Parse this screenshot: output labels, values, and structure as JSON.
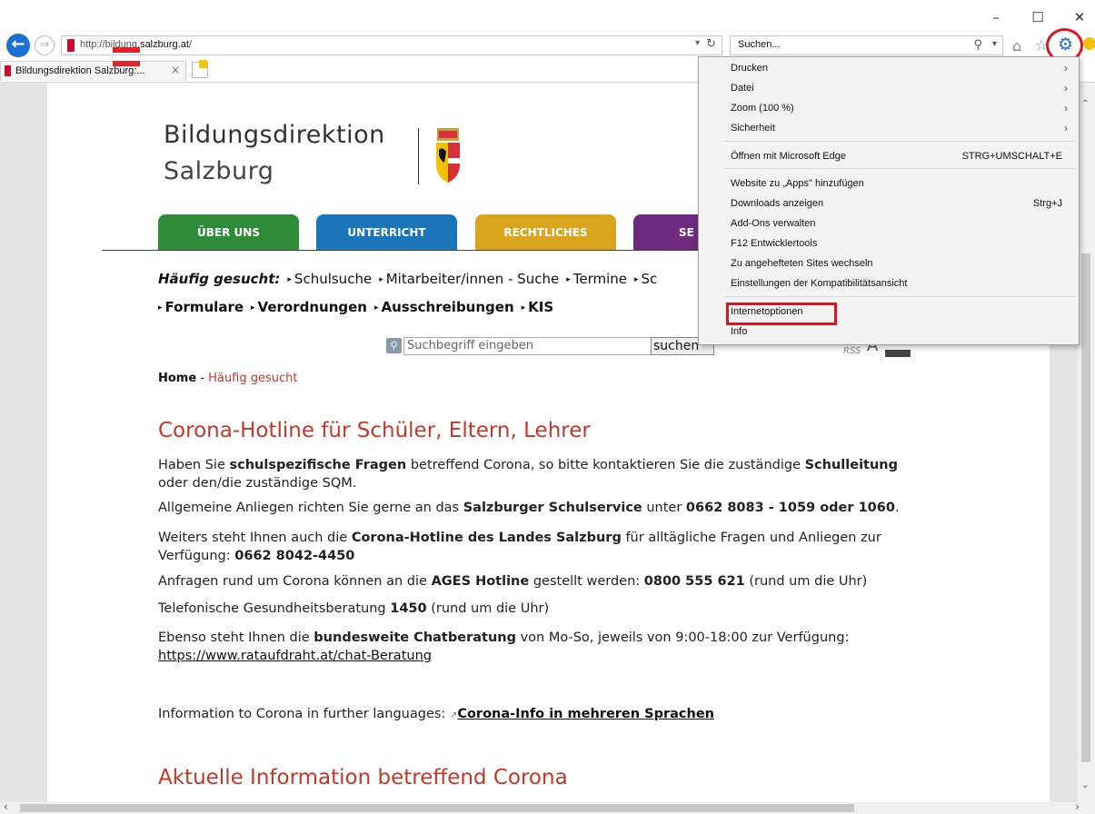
{
  "browser": {
    "window_controls": [
      "–",
      "☐",
      "✕"
    ],
    "address_url_prefix": "http://bildung.",
    "address_url_domain": "salzburg.at",
    "address_url_suffix": "/",
    "search_placeholder": "Suchen...",
    "tab_title": "Bildungsdirektion Salzburg:...",
    "icons": [
      "back-icon",
      "forward-icon",
      "refresh-icon",
      "search-icon",
      "home-icon",
      "star-icon",
      "gear-icon",
      "smiley-icon"
    ]
  },
  "menu": {
    "items": [
      {
        "label": "Drucken",
        "submenu": true
      },
      {
        "label": "Datei",
        "submenu": true
      },
      {
        "label": "Zoom (100 %)",
        "submenu": true
      },
      {
        "label": "Sicherheit",
        "submenu": true
      },
      {
        "label": "Öffnen mit Microsoft Edge",
        "shortcut": "STRG+UMSCHALT+E"
      },
      {
        "label": "Website zu „Apps\" hinzufügen"
      },
      {
        "label": "Downloads anzeigen",
        "shortcut": "Strg+J"
      },
      {
        "label": "Add-Ons verwalten"
      },
      {
        "label": "F12 Entwicklertools"
      },
      {
        "label": "Zu angehefteten Sites wechseln"
      },
      {
        "label": "Einstellungen der Kompatibilitätsansicht"
      },
      {
        "label": "Internetoptionen",
        "highlighted": true
      },
      {
        "label": "Info"
      }
    ]
  },
  "page": {
    "logo_title": "Bildungsdirektion",
    "logo_subtitle": "Salzburg",
    "nav": [
      {
        "label": "ÜBER UNS",
        "color": "#2e8b3a"
      },
      {
        "label": "UNTERRICHT",
        "color": "#1a76b8"
      },
      {
        "label": "RECHTLICHES",
        "color": "#d9a51c"
      },
      {
        "label": "SE",
        "color": "#6e2a7e"
      }
    ],
    "frequent_label": "Häufig gesucht:",
    "frequent_row1": [
      "Schulsuche",
      "Mitarbeiter/innen - Suche",
      "Termine",
      "Sc"
    ],
    "frequent_row2": [
      "Formulare",
      "Verordnungen",
      "Ausschreibungen",
      "KIS"
    ],
    "search_placeholder": "Suchbegriff eingeben",
    "search_button": "suchen",
    "rss": "RSS",
    "font_a": "A",
    "breadcrumb_home": "Home",
    "breadcrumb_sep": " - ",
    "breadcrumb_current": "Häufig gesucht",
    "heading1": "Corona-Hotline für Schüler, Eltern, Lehrer",
    "p1": {
      "a": "Haben Sie ",
      "b": "schulspezifische Fragen",
      "c": " betreffend Corona, so bitte kontaktieren Sie die zuständige ",
      "d": "Schulleitung",
      "e": " oder den/die zuständige SQM."
    },
    "p2": {
      "a": "Allgemeine Anliegen richten Sie gerne an das ",
      "b": "Salzburger Schulservice",
      "c": " unter ",
      "d": "0662 8083 - 1059 oder 1060",
      "e": "."
    },
    "p3": {
      "a": "Weiters steht Ihnen auch die ",
      "b": "Corona-Hotline des Landes Salzburg",
      "c": " für alltägliche Fragen und Anliegen zur Verfügung: ",
      "d": "0662 8042-4450"
    },
    "p4": {
      "a": "Anfragen rund um Corona können an die ",
      "b": "AGES Hotline",
      "c": " gestellt werden: ",
      "d": "0800 555 621",
      "e": " (rund um die Uhr)"
    },
    "p5": {
      "a": "Telefonische Gesundheitsberatung ",
      "b": "1450",
      "c": " (rund um die Uhr)"
    },
    "p6": {
      "a": "Ebenso steht Ihnen die ",
      "b": "bundesweite Chatberatung",
      "c": " von Mo-So, jeweils von 9:00-18:00 zur Verfügung:",
      "link": "https://www.rataufdraht.at/chat-Beratung"
    },
    "p7": {
      "a": "Information to Corona in further languages: ",
      "link": "Corona-Info in mehreren Sprachen"
    },
    "heading2": "Aktuelle Information betreffend Corona"
  }
}
